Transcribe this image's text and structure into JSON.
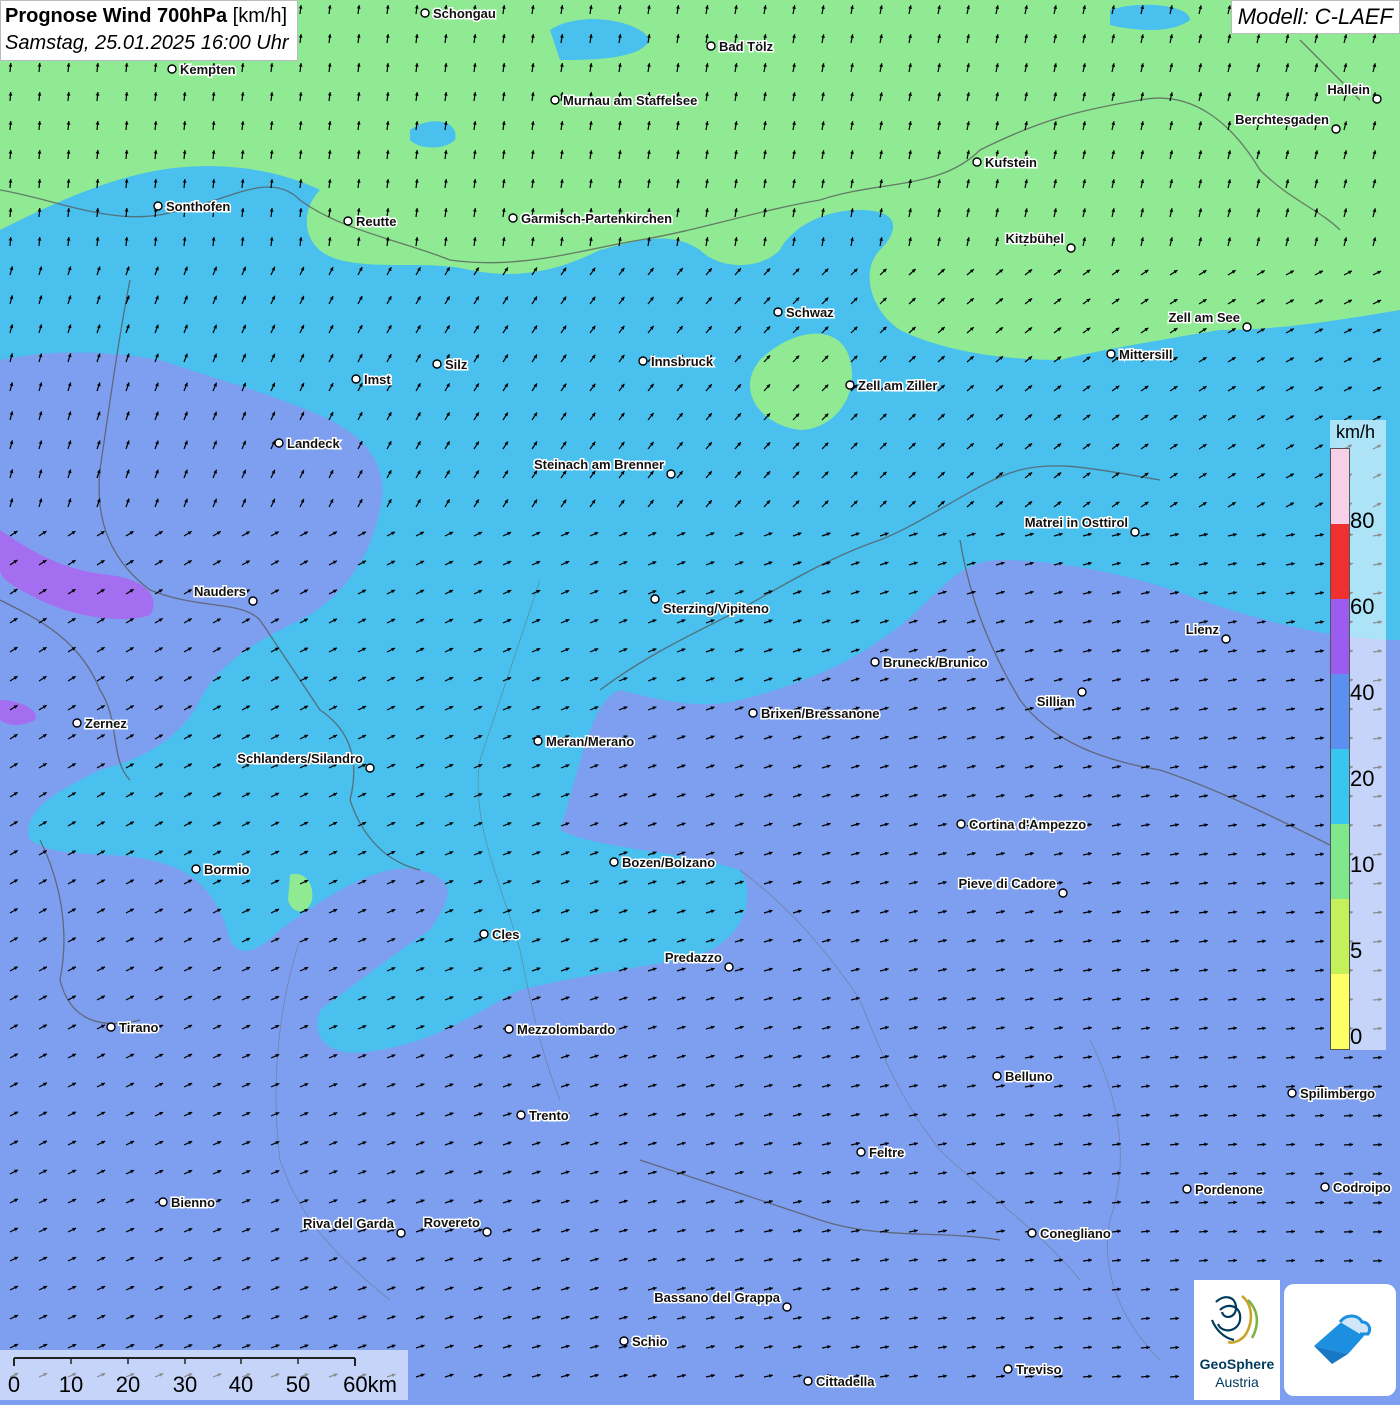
{
  "header": {
    "title_bold": "Prognose Wind 700hPa",
    "title_unit": "[km/h]",
    "date": "Samstag, 25.01.2025 16:00 Uhr",
    "model": "Modell: C-LAEF"
  },
  "legend": {
    "unit": "km/h",
    "labels": [
      "80",
      "60",
      "40",
      "20",
      "10",
      "5",
      "0"
    ],
    "colors": [
      "#ffff66",
      "#c4f05a",
      "#7ee88a",
      "#36c6ef",
      "#5b8ff0",
      "#9b5cf0",
      "#f03030",
      "#f5d0e8"
    ]
  },
  "scale_bar": {
    "labels": [
      "0",
      "10",
      "20",
      "30",
      "40",
      "50",
      "60km"
    ]
  },
  "logos": {
    "geosphere_line1": "GeoSphere",
    "geosphere_line2": "Austria"
  },
  "cities": [
    {
      "name": "Schongau",
      "label": "Schongau"
    },
    {
      "name": "Bad Tölz",
      "label": "Bad Tölz"
    },
    {
      "name": "Kempten",
      "label": "Kempten"
    },
    {
      "name": "Murnau",
      "label": "Murnau am Staffelsee"
    },
    {
      "name": "Hallein",
      "label": "Hallein"
    },
    {
      "name": "Berchtesgaden",
      "label": "Berchtesgaden"
    },
    {
      "name": "Kufstein",
      "label": "Kufstein"
    },
    {
      "name": "Sonthofen",
      "label": "Sonthofen"
    },
    {
      "name": "Reutte",
      "label": "Reutte"
    },
    {
      "name": "Garmisch",
      "label": "Garmisch-Partenkirchen"
    },
    {
      "name": "Kitzbühel",
      "label": "Kitzbühel"
    },
    {
      "name": "Schwaz",
      "label": "Schwaz"
    },
    {
      "name": "Zell am See",
      "label": "Zell am See"
    },
    {
      "name": "Mittersill",
      "label": "Mittersill"
    },
    {
      "name": "Innsbruck",
      "label": "Innsbruck"
    },
    {
      "name": "Silz",
      "label": "Silz"
    },
    {
      "name": "Imst",
      "label": "Imst"
    },
    {
      "name": "Zell am Ziller",
      "label": "Zell am Ziller"
    },
    {
      "name": "Landeck",
      "label": "Landeck"
    },
    {
      "name": "Steinach",
      "label": "Steinach am Brenner"
    },
    {
      "name": "Matrei",
      "label": "Matrei in Osttirol"
    },
    {
      "name": "Nauders",
      "label": "Nauders"
    },
    {
      "name": "Sterzing",
      "label": "Sterzing/Vipiteno"
    },
    {
      "name": "Lienz",
      "label": "Lienz"
    },
    {
      "name": "Bruneck",
      "label": "Bruneck/Brunico"
    },
    {
      "name": "Sillian",
      "label": "Sillian"
    },
    {
      "name": "Brixen",
      "label": "Brixen/Bressanone"
    },
    {
      "name": "Zernez",
      "label": "Zernez"
    },
    {
      "name": "Meran",
      "label": "Meran/Merano"
    },
    {
      "name": "Schlanders",
      "label": "Schlanders/Silandro"
    },
    {
      "name": "Cortina",
      "label": "Cortina d'Ampezzo"
    },
    {
      "name": "Bozen",
      "label": "Bozen/Bolzano"
    },
    {
      "name": "Bormio",
      "label": "Bormio"
    },
    {
      "name": "Pieve",
      "label": "Pieve di Cadore"
    },
    {
      "name": "Cles",
      "label": "Cles"
    },
    {
      "name": "Predazzo",
      "label": "Predazzo"
    },
    {
      "name": "Tirano",
      "label": "Tirano"
    },
    {
      "name": "Mezzolombardo",
      "label": "Mezzolombardo"
    },
    {
      "name": "Belluno",
      "label": "Belluno"
    },
    {
      "name": "Spilimbergo",
      "label": "Spilimbergo"
    },
    {
      "name": "Trento",
      "label": "Trento"
    },
    {
      "name": "Feltre",
      "label": "Feltre"
    },
    {
      "name": "Pordenone",
      "label": "Pordenone"
    },
    {
      "name": "Codroipo",
      "label": "Codroipo"
    },
    {
      "name": "Bienno",
      "label": "Bienno"
    },
    {
      "name": "Riva",
      "label": "Riva del Garda"
    },
    {
      "name": "Rovereto",
      "label": "Rovereto"
    },
    {
      "name": "Conegliano",
      "label": "Conegliano"
    },
    {
      "name": "Bassano",
      "label": "Bassano del Grappa"
    },
    {
      "name": "Schio",
      "label": "Schio"
    },
    {
      "name": "Treviso",
      "label": "Treviso"
    },
    {
      "name": "Cittadella",
      "label": "Cittadella"
    }
  ]
}
